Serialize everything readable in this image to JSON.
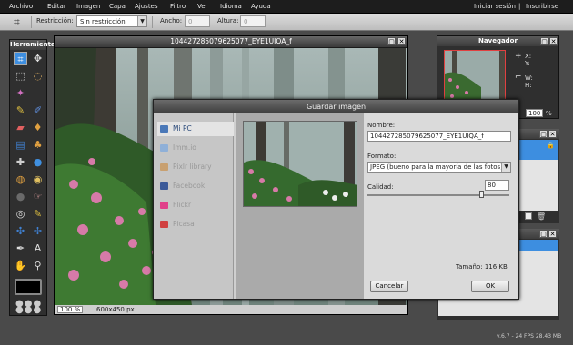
{
  "menu": {
    "items": [
      "Archivo",
      "Editar",
      "Imagen",
      "Capa",
      "Ajustes",
      "Filtro",
      "Ver",
      "Idioma",
      "Ayuda"
    ],
    "login": "Iniciar sesión",
    "separator": "|",
    "register": "Inscribirse"
  },
  "toolbar": {
    "restriction_label": "Restricción:",
    "restriction_value": "Sin restricción",
    "width_label": "Ancho:",
    "width_value": "0",
    "height_label": "Altura:",
    "height_value": "0"
  },
  "tools_panel": {
    "title": "Herramientas"
  },
  "canvas": {
    "title": "104427285079625077_EYE1UIQA_f",
    "zoom": "100",
    "zoom_unit": "%",
    "dimensions": "600x450 px"
  },
  "navigator": {
    "title": "Navegador",
    "x_label": "X:",
    "y_label": "Y:",
    "w_label": "W:",
    "h_label": "H:",
    "zoom": "100",
    "zoom_unit": "%"
  },
  "dialog": {
    "title": "Guardar imagen",
    "sidebar": [
      {
        "label": "Mi PC",
        "icon": "computer-icon",
        "color": "#4a78b8",
        "selected": true
      },
      {
        "label": "Imm.io",
        "icon": "immio-icon",
        "color": "#8fb0d8",
        "selected": false
      },
      {
        "label": "Pixlr library",
        "icon": "library-icon",
        "color": "#c8a070",
        "selected": false
      },
      {
        "label": "Facebook",
        "icon": "facebook-icon",
        "color": "#3b5998",
        "selected": false
      },
      {
        "label": "Flickr",
        "icon": "flickr-icon",
        "color": "#e0408a",
        "selected": false
      },
      {
        "label": "Picasa",
        "icon": "picasa-icon",
        "color": "#d04040",
        "selected": false
      }
    ],
    "name_label": "Nombre:",
    "name_value": "104427285079625077_EYE1UIQA_f",
    "format_label": "Formato:",
    "format_value": "JPEG (bueno para la mayoría de las fotos)",
    "quality_label": "Calidad:",
    "quality_value": "80",
    "quality_fraction": 0.8,
    "size_text": "Tamaño: 116 KB",
    "cancel_label": "Cancelar",
    "ok_label": "OK"
  },
  "footer": {
    "text": "v.6.7 - 24 FPS 28.43 MB"
  },
  "colors": {
    "menubar": "#1d1d1d",
    "selection_blue": "#3d8ee0",
    "panel": "#2f2f2f"
  }
}
